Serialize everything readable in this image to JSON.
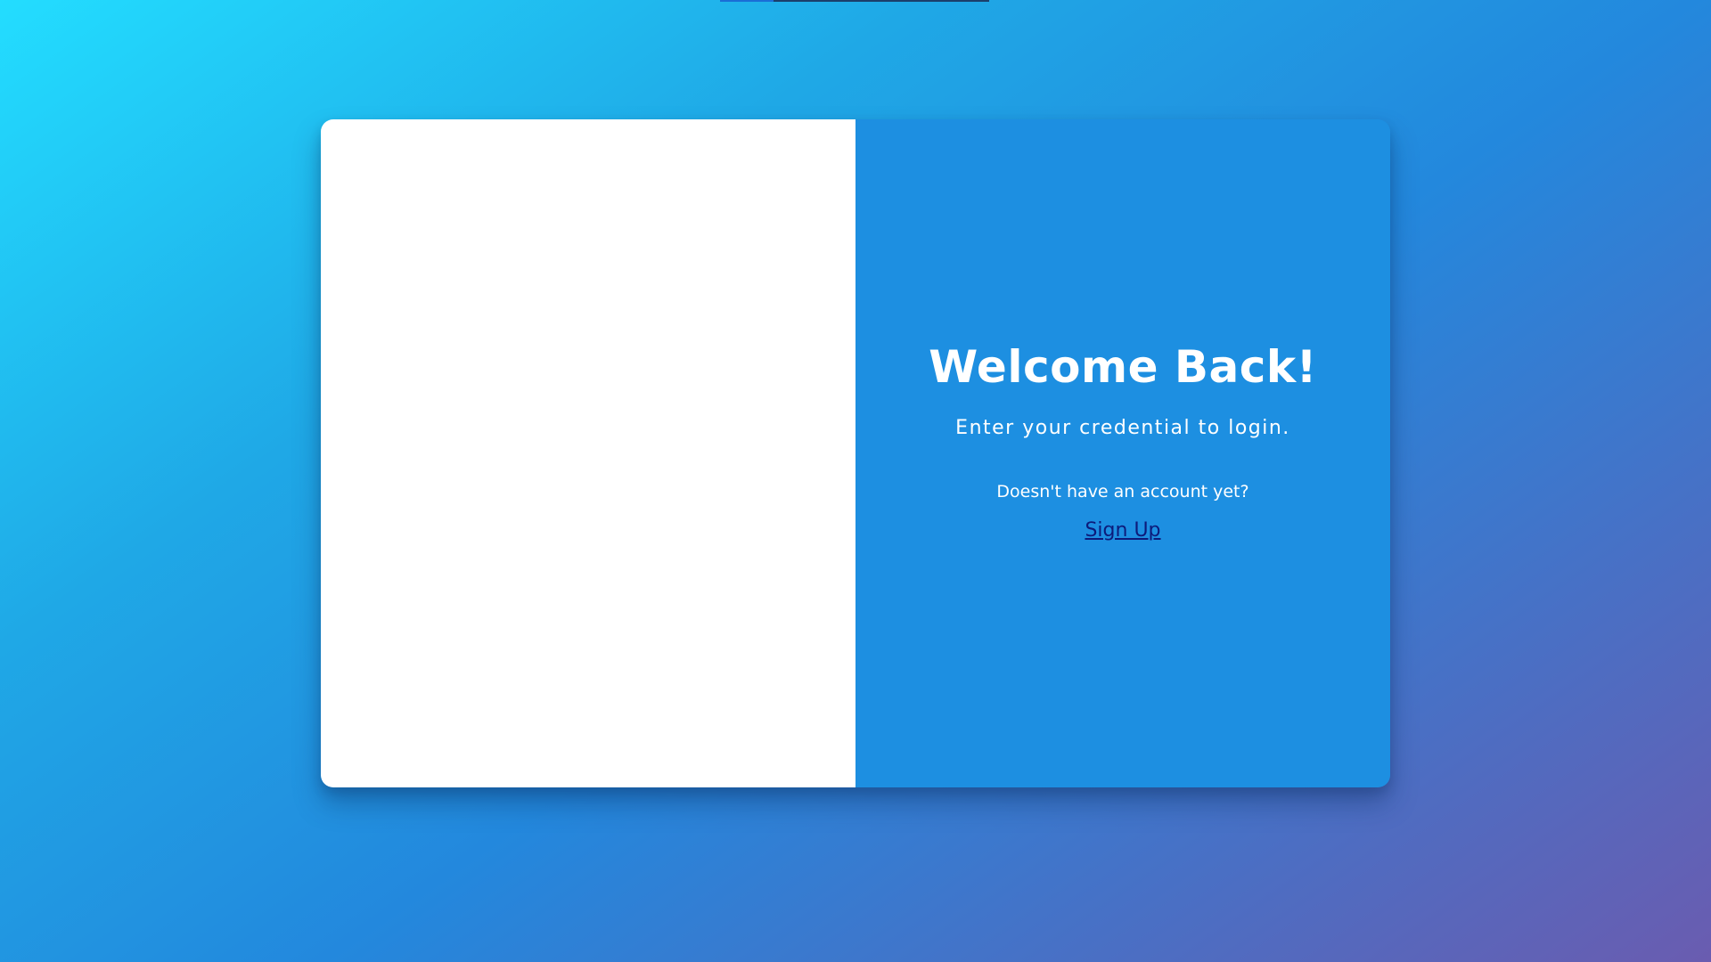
{
  "panel": {
    "title": "Welcome Back!",
    "subtitle": "Enter your credential to login.",
    "no_account_text": "Doesn't have an account yet?",
    "signup_link": "Sign Up"
  },
  "colors": {
    "panel_right_bg": "#1d8fe1",
    "panel_left_bg": "#ffffff",
    "link_color": "#0d1b7a",
    "background_start": "#23ddff",
    "background_end": "#6a5cb0"
  }
}
